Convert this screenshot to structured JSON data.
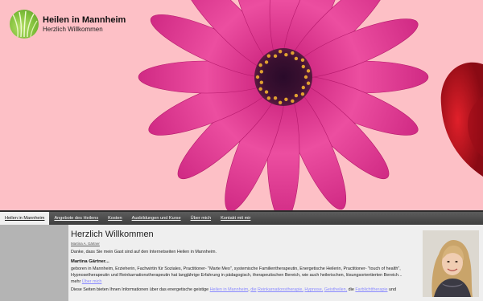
{
  "site": {
    "title": "Heilen in Mannheim",
    "subtitle": "Herzlich Willkommen"
  },
  "nav": [
    {
      "label": "Heilen in Mannheim",
      "active": true
    },
    {
      "label": "Angebote des Heilens",
      "active": false
    },
    {
      "label": "Kosten",
      "active": false
    },
    {
      "label": "Ausbildungen und Kurse",
      "active": false
    },
    {
      "label": "Über mich",
      "active": false
    },
    {
      "label": "Kontakt mit mir",
      "active": false
    }
  ],
  "main": {
    "heading": "Herzlich Willkommen",
    "author_link": "Martina A. Gärtner",
    "welcome_text": "Danke, dass Sie mein Gast sind auf den Internetseiten Heilen in Mannheim.",
    "name_heading": "Martina Gärtner...",
    "bio_text": "geboren in Mannheim, Erzieherin, Fachwirtin für Soziales, Practitioner- \"Marte Meo\", systemische Familientherapeutin, Energetische Heilerin, Practitioner- \"touch of health\", Hypnosetherapeutin und Reinkarnationstherapeutin hat langjährige Erfahrung in pädagogisch, therapeutischen Bereich, wie auch heilerischen, lösungsorientierten Bereich... mehr",
    "bio_link": "Über mich",
    "info_text_start": "Diese Seiten bieten Ihnen Informationen über das energetische geistige",
    "info_link_1": "Heilen in Mannheim",
    "info_link_2": "die",
    "info_link_3": "Reinkarnationstherapie,",
    "info_link_4": "Hypnose,",
    "info_link_5": "Geistheilen,",
    "info_text_mid": "die",
    "info_link_6": "Farblichttherapie",
    "info_text_end": "und"
  },
  "colors": {
    "header_bg": "#fdc0c6",
    "nav_bg": "#4a4a4a",
    "flower_petal": "#e0378f",
    "red_flower": "#c4121f",
    "link": "#8a8aff"
  }
}
